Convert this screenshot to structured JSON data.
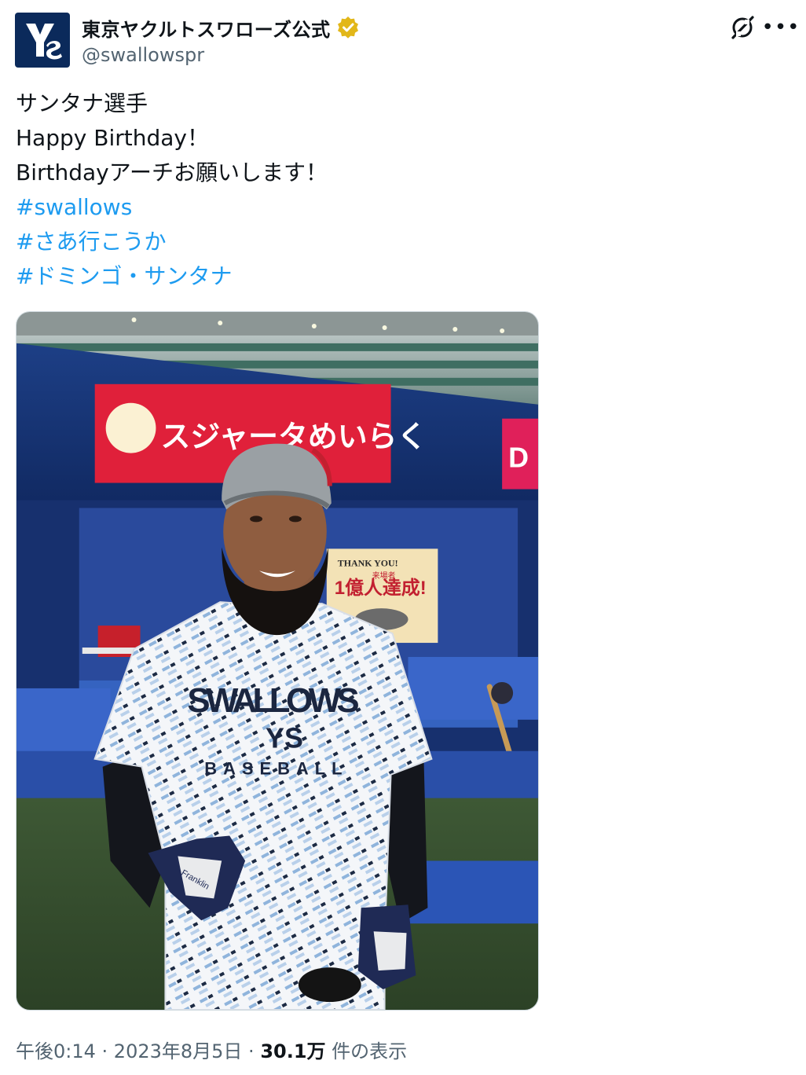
{
  "author": {
    "display_name": "東京ヤクルトスワローズ公式",
    "handle": "@swallowspr",
    "verified_color": "#e2b719",
    "avatar_text": "YS"
  },
  "tweet": {
    "lines": [
      "サンタナ選手",
      "Happy Birthday！",
      "Birthdayアーチお願いします！"
    ],
    "hashtags": [
      "#swallows",
      "#さあ行こうか",
      "#ドミンゴ・サンタナ"
    ]
  },
  "photo": {
    "banner_text": "スジャータめいらく",
    "banner_right_text": "D",
    "sign_top": "THANK YOU!",
    "sign_small": "来場者",
    "sign_main": "1億人達成!",
    "shirt_main": "SWALLOWS",
    "shirt_sub": "BASEBALL",
    "glove_brand": "Franklin"
  },
  "meta": {
    "time": "午後0:14",
    "sep1": " · ",
    "date": "2023年8月5日",
    "sep2": " · ",
    "views": "30.1万",
    "views_label": " 件の表示"
  },
  "colors": {
    "link": "#1d9bf0",
    "secondary": "#536471",
    "primary": "#0f1419"
  }
}
